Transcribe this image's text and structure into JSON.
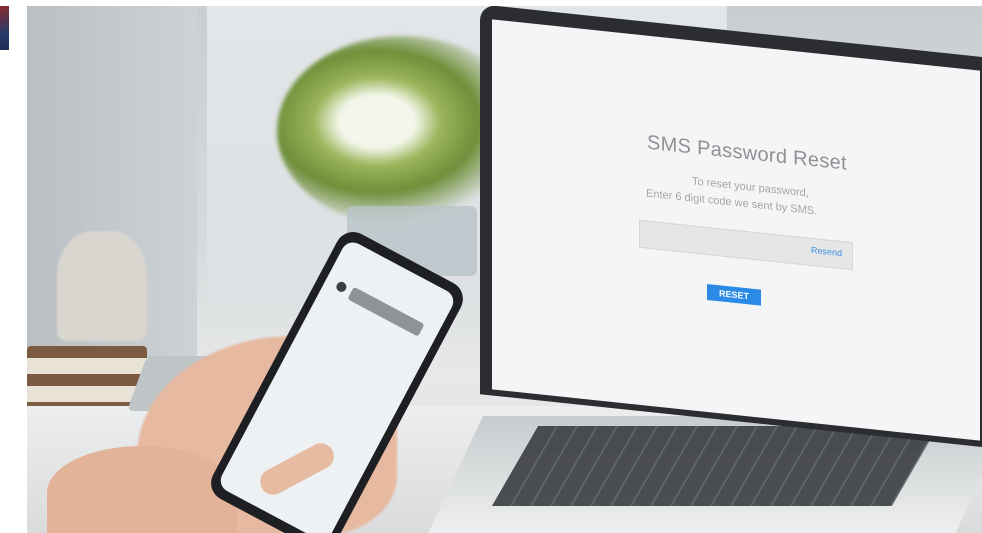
{
  "laptop_screen": {
    "title": "SMS Password Reset",
    "line1": "To reset your password,",
    "line2": "Enter 6 digit code we sent by SMS.",
    "resend_label": "Resend",
    "button_label": "RESET"
  },
  "colors": {
    "accent": "#2b8ae6",
    "link": "#3d8fe3"
  }
}
